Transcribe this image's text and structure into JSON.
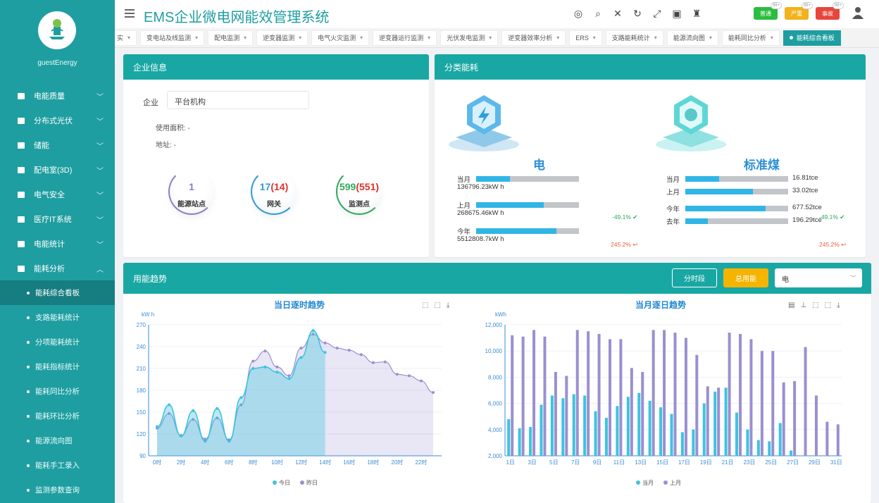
{
  "sidebar": {
    "brand": "guestEnergy",
    "items": [
      {
        "label": "电能质量",
        "icon": "power-quality-icon"
      },
      {
        "label": "分布式光伏",
        "icon": "solar-icon"
      },
      {
        "label": "储能",
        "icon": "storage-icon"
      },
      {
        "label": "配电室(3D)",
        "icon": "house-icon"
      },
      {
        "label": "电气安全",
        "icon": "electric-safety-icon"
      },
      {
        "label": "医疗IT系统",
        "icon": "medical-icon"
      },
      {
        "label": "电能统计",
        "icon": "bar-chart-icon"
      },
      {
        "label": "能耗分析",
        "icon": "analysis-icon"
      }
    ],
    "subitems": [
      "能耗综合看板",
      "支路能耗统计",
      "分项能耗统计",
      "能耗指标统计",
      "能耗同比分析",
      "能耗环比分析",
      "能源流向图",
      "能耗手工录入",
      "监测参数查询"
    ]
  },
  "header": {
    "title": "EMS企业微电网能效管理系统",
    "badges": [
      {
        "label": "普通",
        "count": "99+",
        "color": "#2bbd3f"
      },
      {
        "label": "严重",
        "count": "99+",
        "color": "#f2b21b"
      },
      {
        "label": "事故",
        "count": "99+",
        "color": "#e8453c"
      }
    ]
  },
  "tabs": [
    "实",
    "变电站及线监测",
    "配电监测",
    "逆变器监测",
    "电气火灾监测",
    "逆变器运行监测",
    "光伏发电监测",
    "逆变器效率分析",
    "ERS",
    "支路能耗统计",
    "能源流向图",
    "能耗同比分析",
    "能耗综合看板"
  ],
  "enterprise": {
    "title": "企业信息",
    "label": "企业",
    "value": "平台机构",
    "power_line": "使用面积: -",
    "address_line": "地址: -",
    "stats": [
      {
        "value": "1",
        "extra": "",
        "label": "能源站点",
        "color": "#8a7ec6"
      },
      {
        "value": "17",
        "extra": "(14)",
        "label": "网关",
        "color": "#2e9bd6"
      },
      {
        "value": "599",
        "extra": "(551)",
        "label": "监测点",
        "color": "#2fa85a"
      }
    ]
  },
  "energy": {
    "title": "分类能耗",
    "electric": {
      "title": "电",
      "rows": [
        {
          "label": "当月",
          "value": "136796.23kW h",
          "fill": 0.33
        },
        {
          "label": "上月",
          "value": "268675.46kW h",
          "fill": 0.66
        },
        {
          "label": "今年",
          "value": "5512808.7kW h",
          "fill": 0.78
        }
      ],
      "pct_up": "-49.1%",
      "pct_down": "245.2%"
    },
    "coal": {
      "title": "标准煤",
      "rows": [
        {
          "label": "当月",
          "value": "16.81tce",
          "fill": 0.33
        },
        {
          "label": "上月",
          "value": "33.02tce",
          "fill": 0.66
        },
        {
          "label": "今年",
          "value": "677.52tce",
          "fill": 0.78
        },
        {
          "label": "去年",
          "value": "196.29tce",
          "fill": 0.22
        }
      ],
      "pct_up": "-49.1%",
      "pct_down": "245.2%"
    }
  },
  "trend": {
    "title": "用能趋势",
    "btn_time": "分时段",
    "btn_total": "总用能",
    "select": "电",
    "colors": {
      "today": "#3cc4e0",
      "yesterday": "#9b8fd1",
      "thismonth": "#3cc4e0",
      "lastmonth": "#9b8fd1"
    }
  },
  "chart_data": [
    {
      "type": "area",
      "title": "当日逐时趋势",
      "ylabel": "kW h",
      "ylim": [
        90,
        270
      ],
      "yticks": [
        90,
        120,
        150,
        180,
        210,
        240,
        270
      ],
      "x": [
        "0时",
        "2时",
        "4时",
        "6时",
        "8时",
        "10时",
        "12时",
        "14时",
        "16时",
        "18时",
        "20时",
        "22时"
      ],
      "series": [
        {
          "name": "今日",
          "values": [
            130,
            160,
            117,
            152,
            110,
            155,
            110,
            170,
            210,
            212,
            205,
            196,
            225,
            262,
            232
          ]
        },
        {
          "name": "昨日",
          "values": [
            128,
            148,
            118,
            140,
            113,
            142,
            112,
            160,
            220,
            234,
            212,
            200,
            238,
            257,
            245,
            238,
            235,
            229,
            218,
            219,
            202,
            200,
            193,
            177
          ]
        }
      ]
    },
    {
      "type": "bar",
      "title": "当月逐日趋势",
      "ylabel": "kWh",
      "ylim": [
        2000,
        12000
      ],
      "yticks": [
        "2,000",
        "4,000",
        "6,000",
        "8,000",
        "10,000",
        "12,000"
      ],
      "x": [
        "1日",
        "3日",
        "5日",
        "7日",
        "9日",
        "11日",
        "13日",
        "15日",
        "17日",
        "19日",
        "21日",
        "23日",
        "25日",
        "27日",
        "29日",
        "31日"
      ],
      "series": [
        {
          "name": "当月",
          "values": [
            4800,
            4100,
            4200,
            5900,
            6600,
            6400,
            6700,
            6600,
            5400,
            4900,
            5800,
            6500,
            6800,
            6200,
            5700,
            5200,
            3800,
            4000,
            6000,
            6900,
            7200,
            5300,
            4000,
            3200,
            3100,
            4500,
            2400,
            null,
            null,
            null,
            null
          ]
        },
        {
          "name": "上月",
          "values": [
            11200,
            11100,
            11600,
            11100,
            8400,
            8100,
            11600,
            11500,
            11300,
            10900,
            10900,
            8700,
            8400,
            11600,
            11600,
            11400,
            11000,
            9700,
            7300,
            7200,
            11400,
            11300,
            10900,
            10000,
            10000,
            7600,
            7700,
            10300,
            6600,
            4600,
            4400
          ]
        }
      ]
    }
  ]
}
